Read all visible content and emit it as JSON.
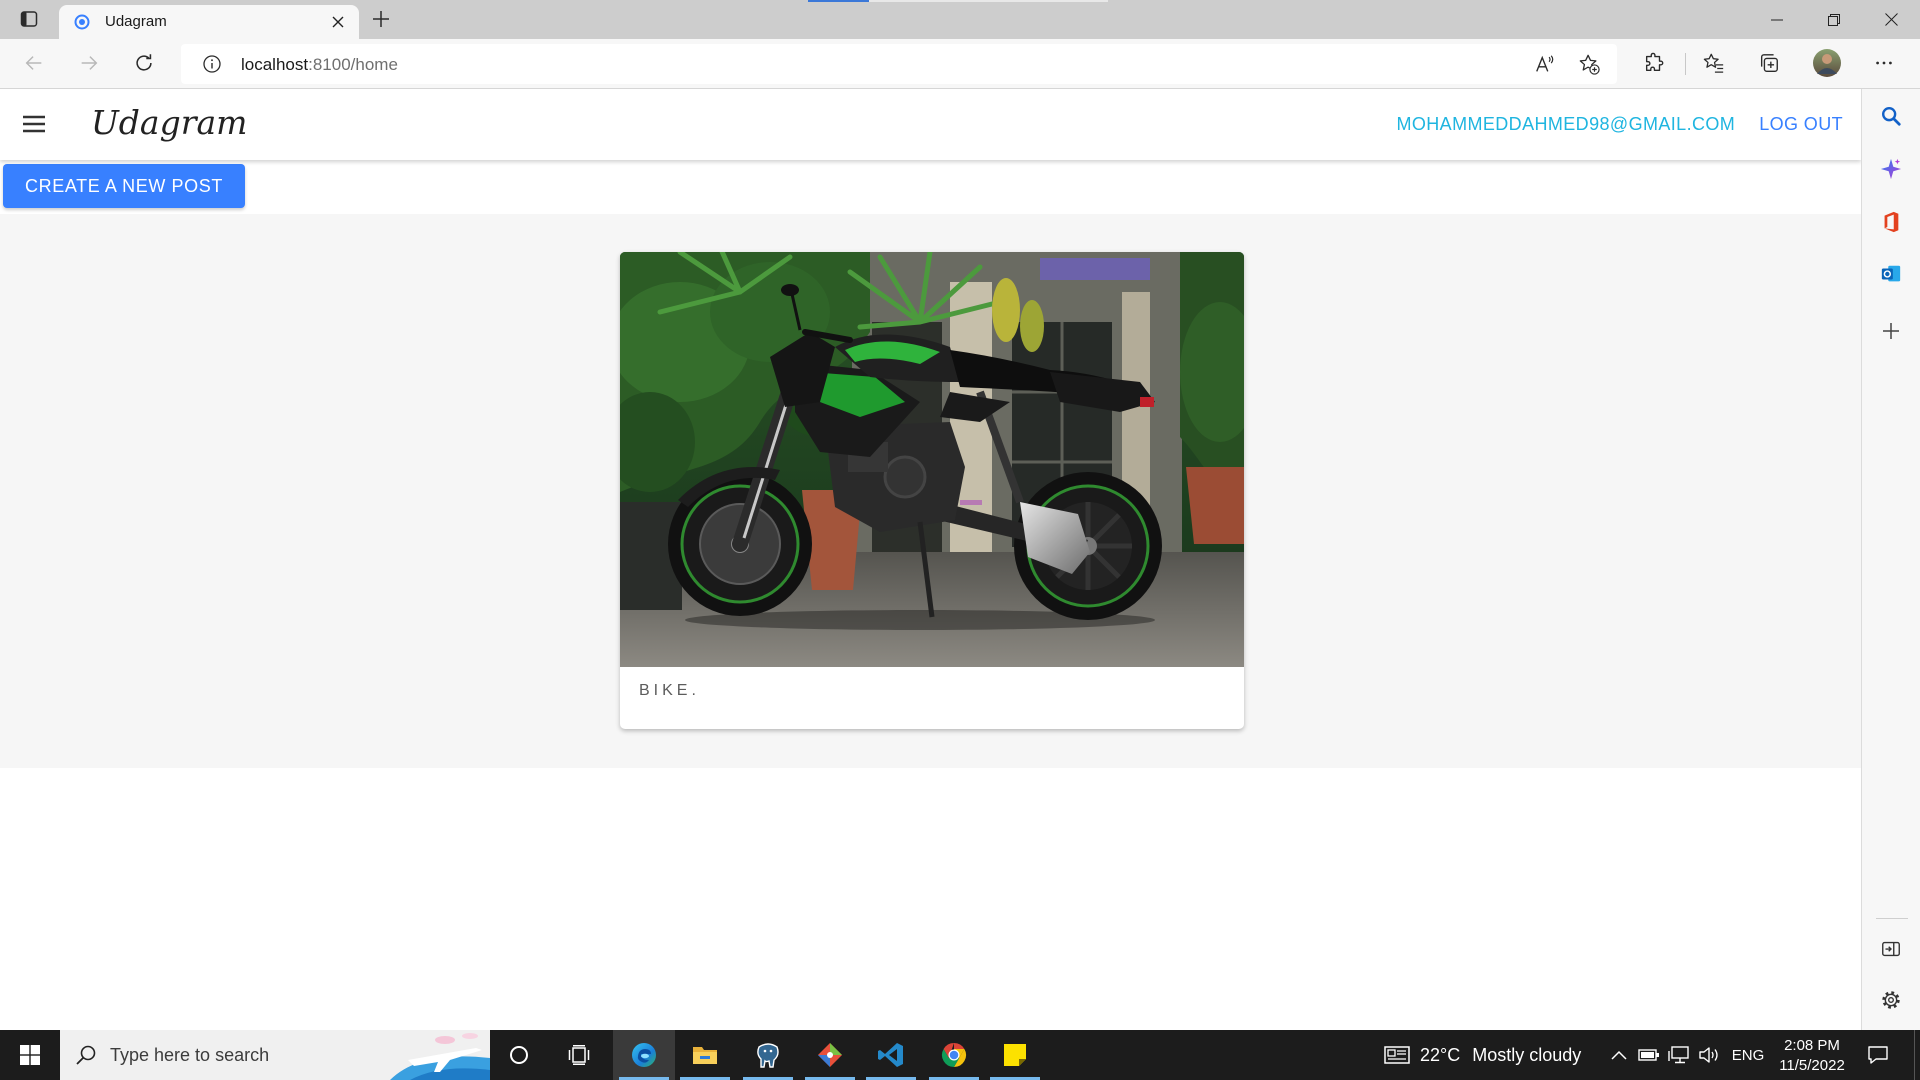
{
  "browser": {
    "tab": {
      "title": "Udagram",
      "favicon": "ionic-favicon-icon"
    },
    "url": {
      "host": "localhost",
      "path": ":8100/home"
    },
    "toolbar_icons": [
      "back-arrow-icon",
      "forward-arrow-icon",
      "refresh-icon",
      "info-icon",
      "read-aloud-icon",
      "favorite-add-icon",
      "extensions-icon",
      "favorites-icon",
      "collections-icon",
      "profile-avatar",
      "more-icon"
    ],
    "sidebar_icons": [
      "search-icon",
      "copilot-icon",
      "office-icon",
      "outlook-icon",
      "plus-icon",
      "sidebar-toggle-icon",
      "gear-icon"
    ]
  },
  "app": {
    "logo": "Udagram",
    "user_email": "MOHAMMEDDAHMED98@GMAIL.COM",
    "logout_label": "LOG OUT",
    "create_post_label": "CREATE A NEW POST"
  },
  "feed": {
    "posts": [
      {
        "caption": "BIKE."
      }
    ]
  },
  "taskbar": {
    "search_placeholder": "Type here to search",
    "pinned_apps": [
      "edge-icon",
      "file-explorer-icon",
      "pgadmin-icon",
      "git-icon",
      "vscode-icon",
      "chrome-icon",
      "sticky-notes-icon"
    ],
    "active_app": "edge-icon",
    "weather": {
      "temp": "22°C",
      "condition": "Mostly cloudy"
    },
    "language": "ENG",
    "time": "2:08 PM",
    "date": "11/5/2022"
  },
  "colors": {
    "primary": "#3880ff",
    "secondary": "#1fb5e0",
    "feed_background": "#f6f6f6",
    "taskbar": "#1c1c1c",
    "running_indicator": "#76b9ed"
  }
}
